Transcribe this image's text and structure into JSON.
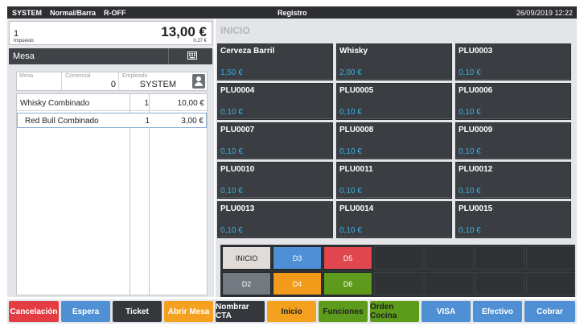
{
  "topbar": {
    "user": "SYSTEM",
    "mode": "Normal/Barra",
    "flag": "R-OFF",
    "title": "Registro",
    "datetime": "26/09/2019 12:22"
  },
  "summary": {
    "qty": "1",
    "total": "13,00 €",
    "tax_label": "Impuesto",
    "tax_value": "0,27 €"
  },
  "mesa": {
    "label": "Mesa",
    "icon": "keyboard-icon"
  },
  "fields": {
    "mesa_caption": "Mesa",
    "mesa_value": "",
    "comensal_caption": "Comensal",
    "comensal_value": "0",
    "empleado_caption": "Empleado",
    "empleado_value": "SYSTEM"
  },
  "ticket": [
    {
      "name": "Whisky Combinado",
      "qty": "1",
      "price": "10,00 €"
    },
    {
      "name": "Red Bull Combinado",
      "qty": "1",
      "price": "3,00 €"
    }
  ],
  "category_title": "INICIO",
  "products": [
    {
      "name": "Cerveza Barril",
      "price": "1,50 €"
    },
    {
      "name": "Whisky",
      "price": "2,00 €"
    },
    {
      "name": "PLU0003",
      "price": "0,10 €"
    },
    {
      "name": "PLU0004",
      "price": "0,10 €"
    },
    {
      "name": "PLU0005",
      "price": "0,10 €"
    },
    {
      "name": "PLU0006",
      "price": "0,10 €"
    },
    {
      "name": "PLU0007",
      "price": "0,10 €"
    },
    {
      "name": "PLU0008",
      "price": "0,10 €"
    },
    {
      "name": "PLU0009",
      "price": "0,10 €"
    },
    {
      "name": "PLU0010",
      "price": "0,10 €"
    },
    {
      "name": "PLU0011",
      "price": "0,10 €"
    },
    {
      "name": "PLU0012",
      "price": "0,10 €"
    },
    {
      "name": "PLU0013",
      "price": "0,10 €"
    },
    {
      "name": "PLU0014",
      "price": "0,10 €"
    },
    {
      "name": "PLU0015",
      "price": "0,10 €"
    }
  ],
  "subcategories": [
    {
      "label": "INICIO",
      "color": "#e1dcd8",
      "text_color": "#222222"
    },
    {
      "label": "D3",
      "color": "#4e8fd6",
      "text_color": "#ffffff"
    },
    {
      "label": "D5",
      "color": "#e0464e",
      "text_color": "#ffffff"
    },
    {
      "label": "D2",
      "color": "#727980",
      "text_color": "#ffffff"
    },
    {
      "label": "D4",
      "color": "#f29b1a",
      "text_color": "#ffffff"
    },
    {
      "label": "D6",
      "color": "#5e9a1c",
      "text_color": "#ffffff"
    }
  ],
  "actions": [
    {
      "label": "Cancelación",
      "color": "#e33d43",
      "text_color": "#ffffff"
    },
    {
      "label": "Espera",
      "color": "#4f8fd4",
      "text_color": "#ffffff"
    },
    {
      "label": "Ticket",
      "color": "#34373b",
      "text_color": "#ffffff"
    },
    {
      "label": "Abrir Mesa",
      "color": "#f4a11f",
      "text_color": "#ffffff"
    },
    {
      "label": "Nombrar CTA",
      "color": "#34373b",
      "text_color": "#ffffff"
    },
    {
      "label": "Inicio",
      "color": "#f4a11f",
      "text_color": "#222222"
    },
    {
      "label": "Funciones",
      "color": "#5d9c1b",
      "text_color": "#222222"
    },
    {
      "label": "Orden Cocina",
      "color": "#5d9c1b",
      "text_color": "#222222"
    },
    {
      "label": "VISA",
      "color": "#4f8fd4",
      "text_color": "#ffffff"
    },
    {
      "label": "Efectivo",
      "color": "#4f8fd4",
      "text_color": "#ffffff"
    },
    {
      "label": "Cobrar",
      "color": "#4f8fd4",
      "text_color": "#ffffff"
    }
  ]
}
